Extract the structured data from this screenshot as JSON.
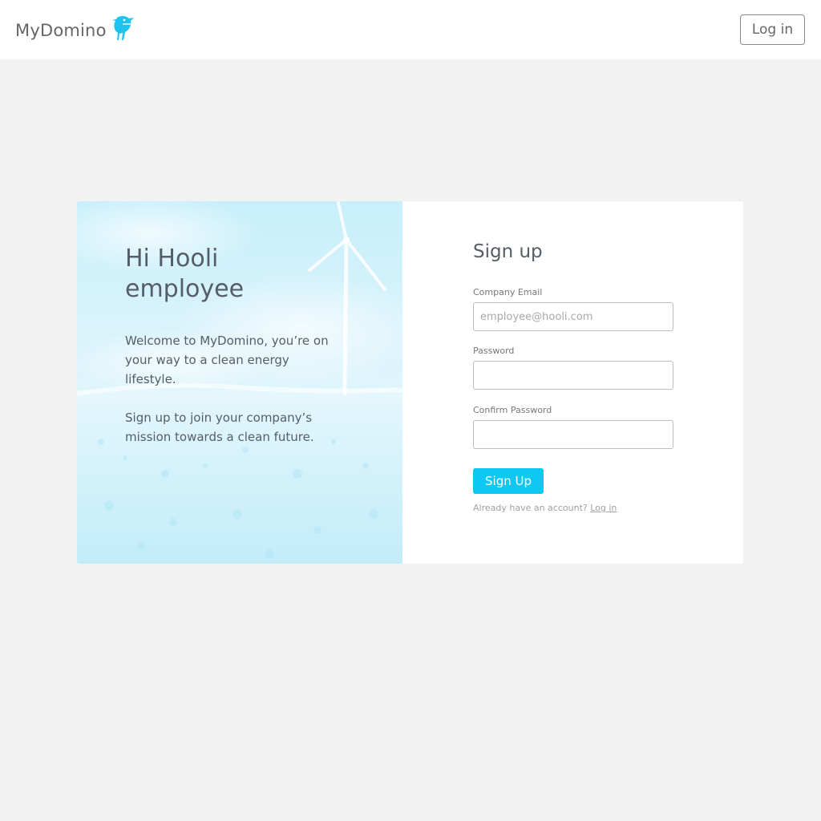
{
  "header": {
    "logo_text": "MyDomino",
    "login_label": "Log in"
  },
  "hero": {
    "title": "Hi Hooli employee",
    "paragraph1": "Welcome to MyDomino, you’re on your way to a clean energy lifestyle.",
    "paragraph2": "Sign up to join your company’s mission towards a clean future."
  },
  "form": {
    "title": "Sign up",
    "email_label": "Company Email",
    "email_placeholder": "employee@hooli.com",
    "email_value": "",
    "password_label": "Password",
    "password_value": "",
    "confirm_label": "Confirm Password",
    "confirm_value": "",
    "submit_label": "Sign Up",
    "already_text": "Already have an account?",
    "login_link": "Log in"
  },
  "colors": {
    "accent": "#0fc8f2",
    "page_bg": "#f2f2f2",
    "card_bg": "#ffffff"
  },
  "icons": {
    "logo_mark": "bird-logo-icon"
  }
}
